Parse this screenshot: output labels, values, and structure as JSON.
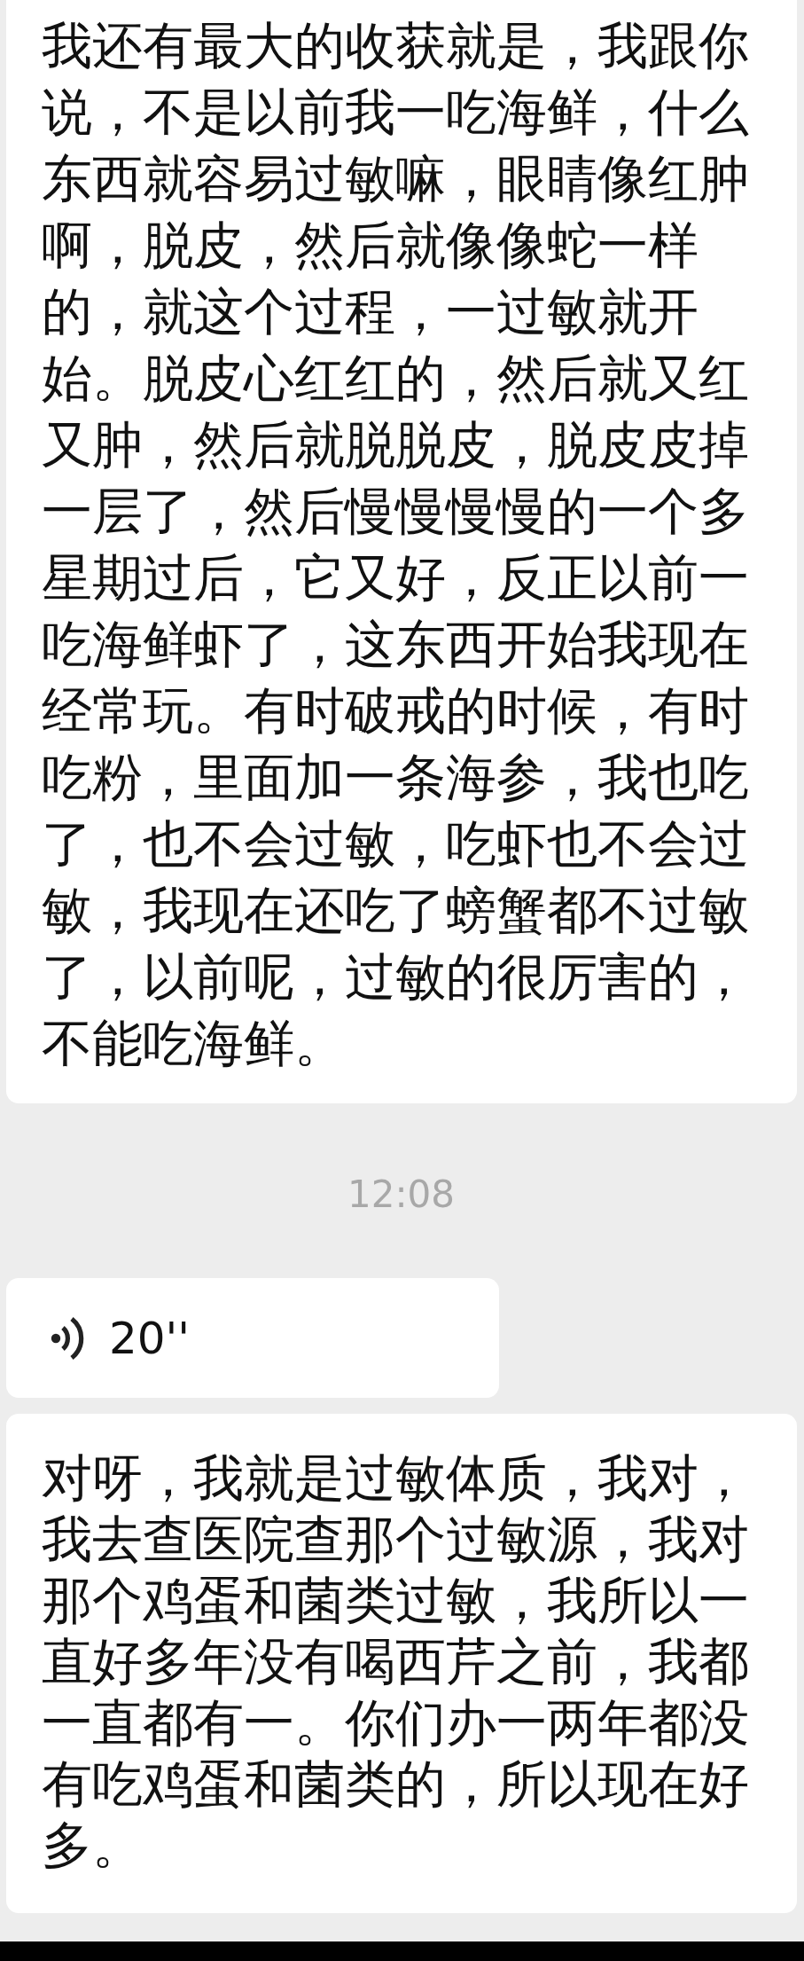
{
  "messages": [
    {
      "kind": "text",
      "text": "我还有最大的收获就是，我跟你说，不是以前我一吃海鲜，什么东西就容易过敏嘛，眼睛像红肿啊，脱皮，然后就像像蛇一样的，就这个过程，一过敏就开始。脱皮心红红的，然后就又红又肿，然后就脱脱皮，脱皮皮掉一层了，然后慢慢慢慢的一个多星期过后，它又好，反正以前一吃海鲜虾了，这东西开始我现在经常玩。有时破戒的时候，有时吃粉，里面加一条海参，我也吃了，也不会过敏，吃虾也不会过敏，我现在还吃了螃蟹都不过敏了，以前呢，过敏的很厉害的，不能吃海鲜。"
    },
    {
      "kind": "time",
      "text": "12:08"
    },
    {
      "kind": "voice",
      "text": "20''"
    },
    {
      "kind": "text",
      "text": "对呀，我就是过敏体质，我对，我去查医院查那个过敏源，我对那个鸡蛋和菌类过敏，我所以一直好多年没有喝西芹之前，我都一直都有一。你们办一两年都没有吃鸡蛋和菌类的，所以现在好多。"
    }
  ]
}
